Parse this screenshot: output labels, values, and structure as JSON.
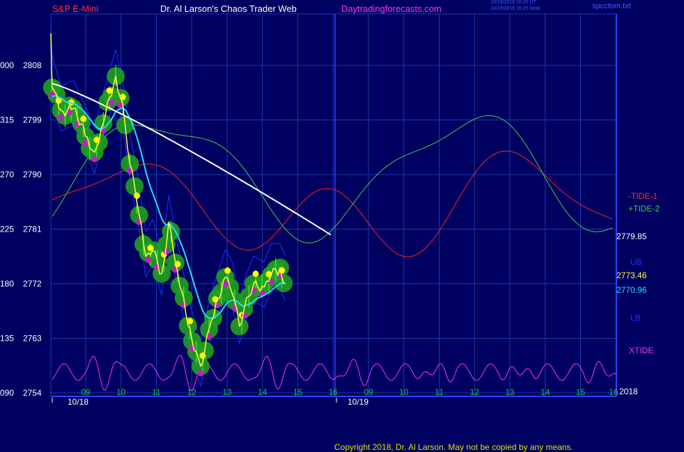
{
  "header": {
    "symbol": "S&P E-Mini",
    "site_title": "Dr. Al Larson's Chaos Trader Web",
    "site_url": "Daytradingforecasts.com",
    "stamp_ut": "10/19/2018 20:20 UT",
    "stamp_local": "10/19/2018 15:20 local",
    "file": "spcctom.txt"
  },
  "colors": {
    "background": "#000060",
    "grid": "#1a3ab0",
    "price_axis": "#ffffff",
    "tide1": "#ff2020",
    "tide2": "#40d040",
    "xtide": "#ff30ff",
    "ub": "#2030ff",
    "lb": "#2030ff",
    "cyan_avg": "#20e0ff",
    "white_avg": "#ffffff",
    "price": "#ffff40",
    "dots_high": "#ffff00",
    "dots_low": "#c020c0",
    "glow": "#20a020"
  },
  "chart_data": {
    "type": "line",
    "title": "S&P E-Mini",
    "y_tick_labels": [
      [
        "000",
        "2808"
      ],
      [
        "315",
        "2799"
      ],
      [
        "270",
        "2790"
      ],
      [
        "225",
        "2781"
      ],
      [
        "180",
        "2772"
      ],
      [
        "135",
        "2763"
      ],
      [
        "090",
        "2754"
      ]
    ],
    "ylim": [
      2754,
      2808
    ],
    "x_tick_labels": [
      "09",
      "10",
      "11",
      "12",
      "13",
      "14",
      "15",
      "16",
      "09",
      "10",
      "11",
      "12",
      "13",
      "14",
      "15",
      "16"
    ],
    "date_labels": [
      "10/18",
      "10/19"
    ],
    "end_label": "2018",
    "right_values": [
      "2779.85",
      "2773.46",
      "2770.96"
    ],
    "series": [
      {
        "name": "-TIDE-1",
        "legend": "-TIDE-1"
      },
      {
        "name": "+TIDE-2",
        "legend": "+TIDE-2"
      },
      {
        "name": "UB",
        "legend": "UB"
      },
      {
        "name": "LB",
        "legend": "LB"
      },
      {
        "name": "XTIDE",
        "legend": "XTIDE"
      }
    ],
    "price_path": [
      [
        0,
        2805
      ],
      [
        0.25,
        2800
      ],
      [
        0.6,
        2801
      ],
      [
        1.0,
        2796
      ],
      [
        1.2,
        2793
      ],
      [
        1.45,
        2799
      ],
      [
        1.8,
        2806
      ],
      [
        2.0,
        2801
      ],
      [
        2.2,
        2792
      ],
      [
        2.4,
        2786
      ],
      [
        2.65,
        2776
      ],
      [
        2.85,
        2778
      ],
      [
        3.1,
        2773
      ],
      [
        3.3,
        2782
      ],
      [
        3.55,
        2774
      ],
      [
        3.9,
        2764
      ],
      [
        4.2,
        2758
      ],
      [
        4.5,
        2766
      ],
      [
        4.9,
        2773
      ],
      [
        5.1,
        2771
      ],
      [
        5.3,
        2765
      ],
      [
        5.5,
        2769
      ],
      [
        5.7,
        2772
      ],
      [
        6.0,
        2771
      ],
      [
        6.2,
        2774
      ],
      [
        6.45,
        2774
      ],
      [
        6.6,
        2772
      ]
    ],
    "last_price": "2773.46",
    "cyan_avg_last": "2770.96",
    "white_avg_last": "2779.85"
  },
  "copyright": "Copyright 2018, Dr. Al Larson. May not be copied by any means."
}
